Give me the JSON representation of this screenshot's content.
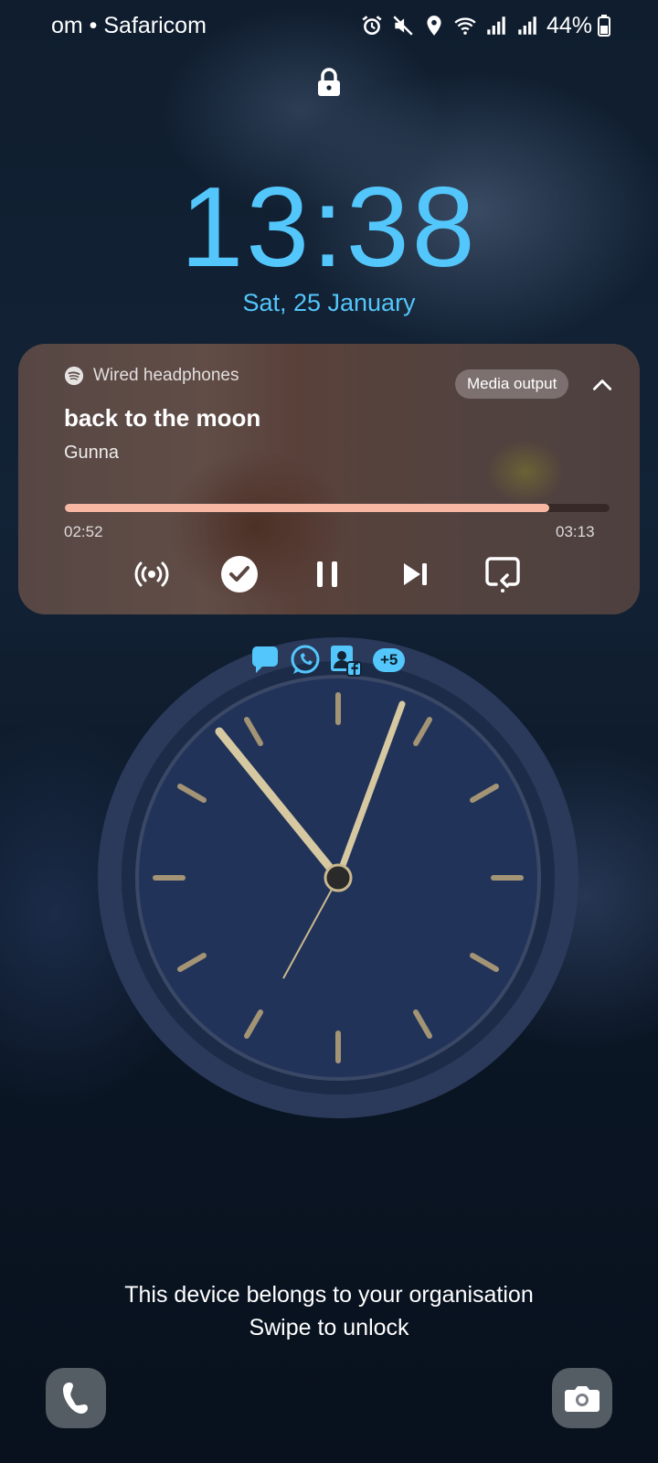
{
  "status_bar": {
    "carrier": "om • Safaricom",
    "battery": "44%",
    "icons": [
      "alarm-icon",
      "mute-icon",
      "location-icon",
      "wifi-icon",
      "signal-icon",
      "signal-icon",
      "battery-icon"
    ]
  },
  "lock_screen": {
    "time": "13:38",
    "date": "Sat, 25 January",
    "org_notice": "This device belongs to your organisation",
    "swipe_hint": "Swipe to unlock"
  },
  "media_player": {
    "app_icon": "spotify-icon",
    "output_device": "Wired headphones",
    "media_output_label": "Media output",
    "title": "back to the moon",
    "artist": "Gunna",
    "elapsed": "02:52",
    "duration": "03:13",
    "progress_fraction": 0.89,
    "controls": [
      "broadcast-icon",
      "check-icon",
      "pause-icon",
      "next-track-icon",
      "cast-icon"
    ]
  },
  "notifications": {
    "icons": [
      "messages-icon",
      "whatsapp-icon",
      "facebook-contacts-icon"
    ],
    "more_count": "+5"
  },
  "shortcuts": [
    "phone-icon",
    "camera-icon"
  ],
  "colors": {
    "accent_clock": "#53c6fb",
    "progress_fill": "#f7b7a3"
  }
}
